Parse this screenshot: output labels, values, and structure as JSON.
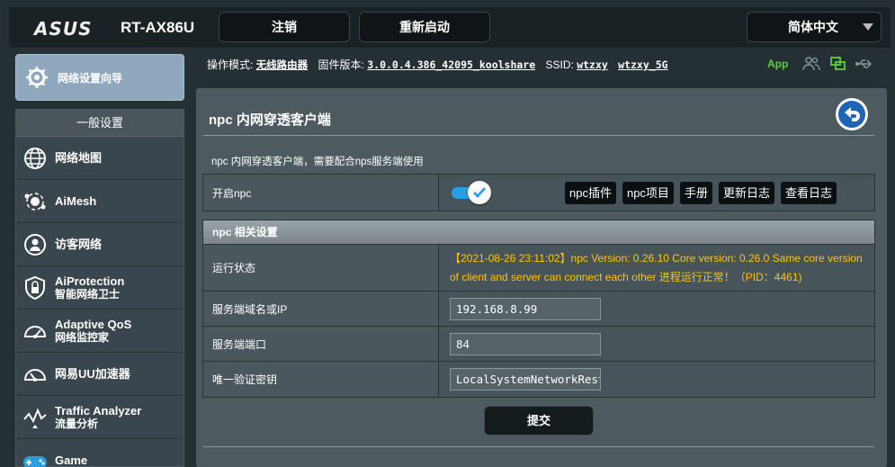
{
  "header": {
    "brand": "ASUS",
    "model": "RT-AX86U",
    "logout_label": "注销",
    "reboot_label": "重新启动",
    "language": "简体中文"
  },
  "sidebar": {
    "quick_setup": "网络设置向导",
    "section_title": "一般设置",
    "items": [
      {
        "l1": "网络地图",
        "l2": ""
      },
      {
        "l1": "AiMesh",
        "l2": ""
      },
      {
        "l1": "访客网络",
        "l2": ""
      },
      {
        "l1": "AiProtection",
        "l2": "智能网络卫士"
      },
      {
        "l1": "Adaptive QoS",
        "l2": "网络监控家"
      },
      {
        "l1": "网易UU加速器",
        "l2": ""
      },
      {
        "l1": "Traffic Analyzer",
        "l2": "流量分析"
      },
      {
        "l1": "Game",
        "l2": ""
      }
    ]
  },
  "status": {
    "mode_label": "操作模式:",
    "mode_value": "无线路由器",
    "fw_label": "固件版本:",
    "fw_value": "3.0.0.4.386_42095_koolshare",
    "ssid_label": "SSID:",
    "ssid_1": "wtzxy",
    "ssid_2": "wtzxy_5G",
    "app_label": "App",
    "app_color": "#5cd03a"
  },
  "main": {
    "title": "npc 内网穿透客户端",
    "description": "npc 内网穿透客户端，需要配合nps服务端使用",
    "enable_label": "开启npc",
    "enabled": true,
    "buttons": [
      "npc插件",
      "npc项目",
      "手册",
      "更新日志",
      "查看日志"
    ],
    "section_title": "npc 相关设置",
    "run_status_label": "运行状态",
    "run_status_line1": "【2021-08-26 23:11:02】npc Version: 0.26.10 Core version: 0.26.0 Same core version",
    "run_status_line2": "of client and server can connect each other 进程运行正常！（PID：4461)",
    "server_ip_label": "服务端域名或IP",
    "server_ip_value": "192.168.8.99",
    "server_port_label": "服务端端口",
    "server_port_value": "84",
    "vkey_label": "唯一验证密钥",
    "vkey_value": "LocalSystemNetworkRestricted",
    "submit_label": "提交",
    "status_color": "#ffc400"
  }
}
